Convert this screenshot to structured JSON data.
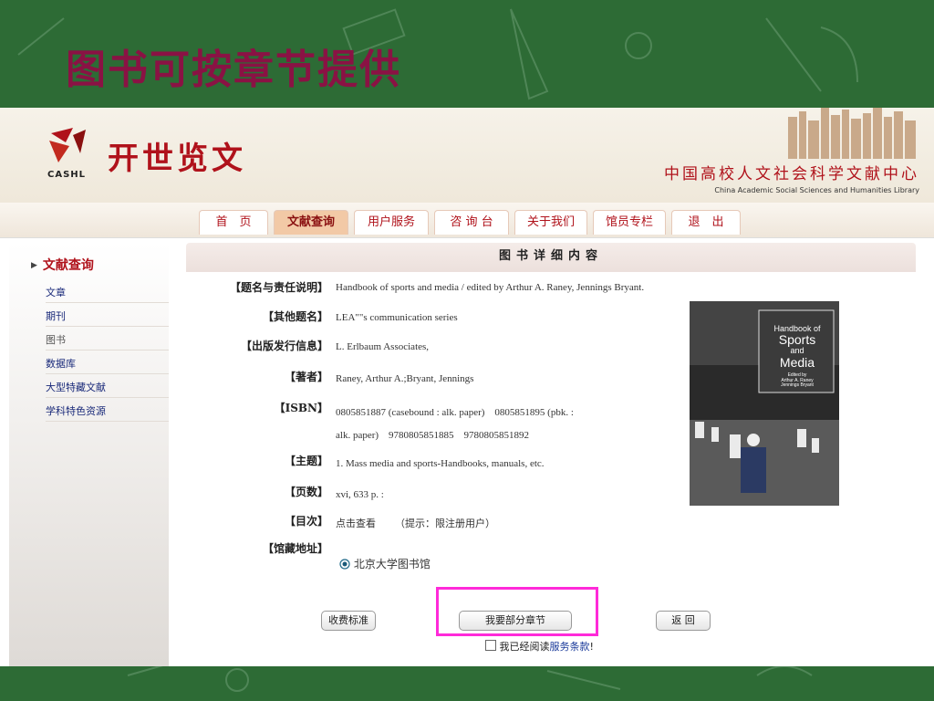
{
  "slide": {
    "title": "图书可按章节提供"
  },
  "header": {
    "logo_badge": "CASHL",
    "logo_name": "开世览文",
    "org_cn": "中国高校人文社会科学文献中心",
    "org_en": "China Academic Social Sciences and Humanities Library"
  },
  "nav": {
    "items": [
      "首　页",
      "文献查询",
      "用户服务",
      "咨 询 台",
      "关于我们",
      "馆员专栏",
      "退　出"
    ],
    "active": "文献查询"
  },
  "sidebar": {
    "heading": "文献查询",
    "links": [
      "文章",
      "期刊",
      "图书",
      "数据库",
      "大型特藏文献",
      "学科特色资源"
    ]
  },
  "detail": {
    "heading": "图书详细内容",
    "fields": {
      "title_label": "【题名与责任说明】",
      "title_value": "Handbook of sports and media / edited by Arthur A. Raney, Jennings Bryant.",
      "other_title_label": "【其他题名】",
      "other_title_value": "LEA\"\"s communication series",
      "publisher_label": "【出版发行信息】",
      "publisher_value": "L. Erlbaum Associates,",
      "author_label": "【著者】",
      "author_value": "Raney, Arthur A.;Bryant, Jennings",
      "isbn_label": "【ISBN】",
      "isbn_value_1": "0805851887 (casebound : alk. paper)　0805851895 (pbk. :",
      "isbn_value_2": "alk. paper)　9780805851885　9780805851892",
      "subject_label": "【主题】",
      "subject_value": "1. Mass media and sports-Handbooks, manuals, etc.",
      "pages_label": "【页数】",
      "pages_value": "xvi, 633 p. :",
      "toc_label": "【目次】",
      "toc_link": "点击查看",
      "toc_hint": "（提示：限注册用户）",
      "holding_label": "【馆藏地址】",
      "holding_value": "北京大学图书馆"
    },
    "cover": {
      "line1": "Handbook of",
      "line2": "Sports",
      "line3": "and",
      "line4": "Media",
      "line5": "Edited by",
      "line6": "Arthur A. Raney",
      "line7": "Jennings Bryant"
    },
    "buttons": {
      "fee": "收费标准",
      "request": "我要部分章节",
      "back": "返 回"
    },
    "agree": {
      "prefix": "我已经阅读",
      "link": "服务条款",
      "suffix": "!"
    }
  },
  "colors": {
    "board": "#2d6b35",
    "slide_title": "#8a1244",
    "brand_red": "#b0121b",
    "highlight": "#ff2ad9"
  }
}
